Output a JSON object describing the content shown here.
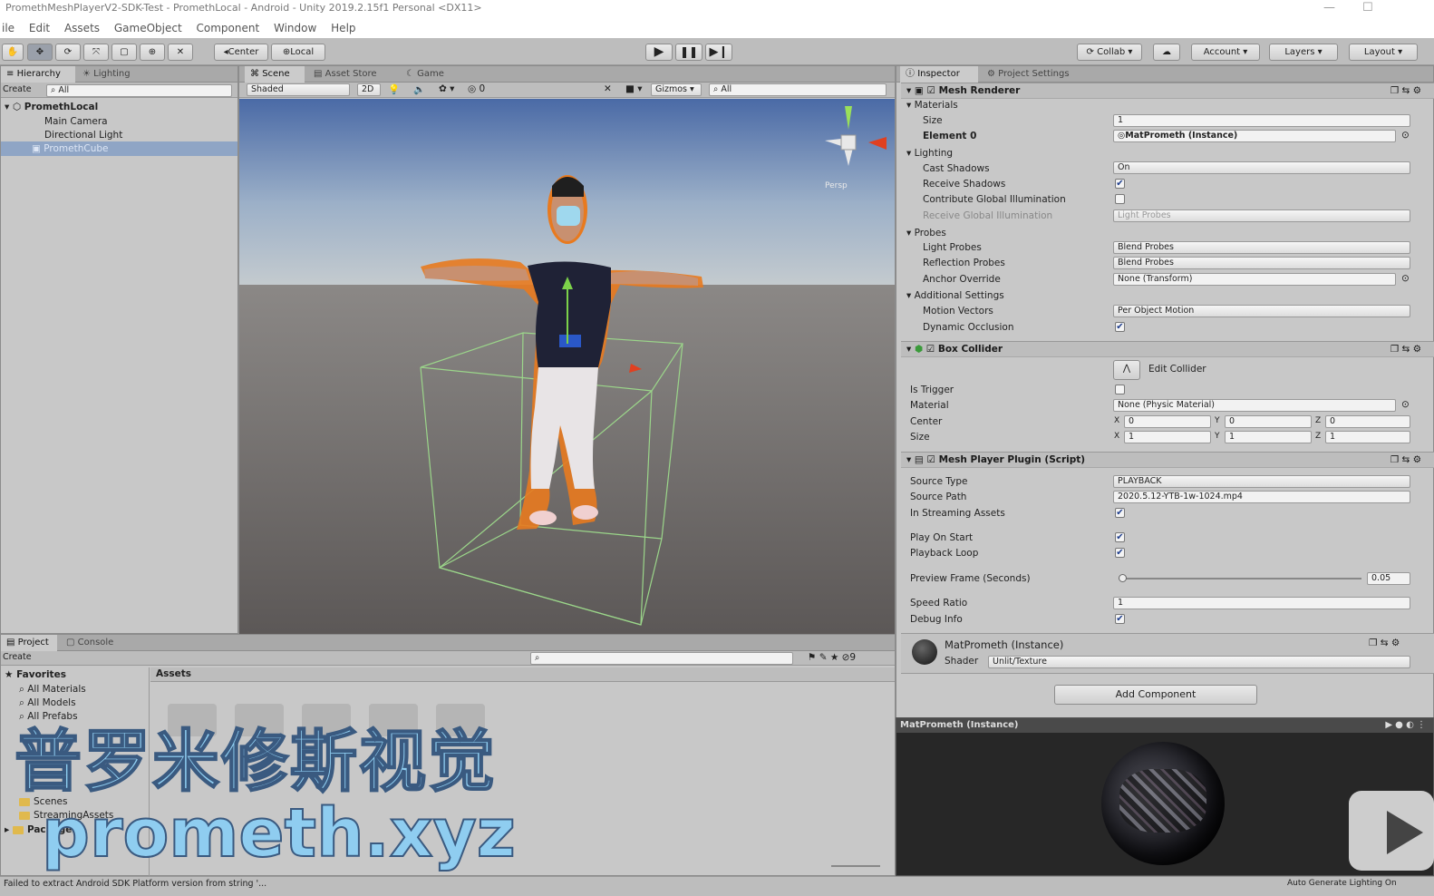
{
  "window": {
    "title": "PromethMeshPlayerV2-SDK-Test - PromethLocal - Android - Unity 2019.2.15f1 Personal <DX11>",
    "ctrl_min": "—",
    "ctrl_max": "☐"
  },
  "menu": [
    "ile",
    "Edit",
    "Assets",
    "GameObject",
    "Component",
    "Window",
    "Help"
  ],
  "toolbar": {
    "center": "Center",
    "local": "Local",
    "collab": "Collab",
    "account": "Account",
    "layers": "Layers",
    "layout": "Layout"
  },
  "hierarchy": {
    "tabs": [
      "Hierarchy",
      "Lighting"
    ],
    "create": "Create",
    "search": "All",
    "scene": "PromethLocal",
    "items": [
      "Main Camera",
      "Directional Light",
      "PromethCube"
    ]
  },
  "scene": {
    "tabs": [
      "Scene",
      "Asset Store",
      "Game"
    ],
    "shading": "Shaded",
    "mode2d": "2D",
    "fx_count": "0",
    "gizmos": "Gizmos",
    "search": "All",
    "persp": "Persp"
  },
  "inspector": {
    "tabs": [
      "Inspector",
      "Project Settings"
    ],
    "mesh_renderer": {
      "title": "Mesh Renderer",
      "materials": "Materials",
      "size_label": "Size",
      "size": "1",
      "element_label": "Element 0",
      "element": "MatPrometh (Instance)",
      "lighting": "Lighting",
      "cast_shadows_label": "Cast Shadows",
      "cast_shadows": "On",
      "receive_shadows": "Receive Shadows",
      "contribute_gi": "Contribute Global Illumination",
      "receive_gi_label": "Receive Global Illumination",
      "receive_gi": "Light Probes",
      "probes": "Probes",
      "light_probes_label": "Light Probes",
      "light_probes": "Blend Probes",
      "reflection_label": "Reflection Probes",
      "reflection": "Blend Probes",
      "anchor_label": "Anchor Override",
      "anchor": "None (Transform)",
      "additional": "Additional Settings",
      "motion_label": "Motion Vectors",
      "motion": "Per Object Motion",
      "dynamic_occlusion": "Dynamic Occlusion"
    },
    "box_collider": {
      "title": "Box Collider",
      "edit": "Edit Collider",
      "is_trigger": "Is Trigger",
      "material_label": "Material",
      "material": "None (Physic Material)",
      "center_label": "Center",
      "center": [
        "0",
        "0",
        "0"
      ],
      "size_label": "Size",
      "size": [
        "1",
        "1",
        "1"
      ],
      "axes": [
        "X",
        "Y",
        "Z"
      ]
    },
    "script": {
      "title": "Mesh Player Plugin (Script)",
      "source_type_label": "Source Type",
      "source_type": "PLAYBACK",
      "source_path_label": "Source Path",
      "source_path": "2020.5.12-YTB-1w-1024.mp4",
      "streaming": "In Streaming Assets",
      "play_on_start": "Play On Start",
      "loop": "Playback Loop",
      "preview_label": "Preview Frame (Seconds)",
      "preview": "0.05",
      "preview_fraction": 0.0,
      "speed_label": "Speed Ratio",
      "speed": "1",
      "debug": "Debug Info"
    },
    "material": {
      "name": "MatPrometh (Instance)",
      "shader_label": "Shader",
      "shader": "Unlit/Texture"
    },
    "add_component": "Add Component",
    "preview_title": "MatPrometh (Instance)"
  },
  "project": {
    "tabs": [
      "Project",
      "Console"
    ],
    "create": "Create",
    "favorites": "Favorites",
    "fav_items": [
      "All Materials",
      "All Models",
      "All Prefabs"
    ],
    "assets_header": "Assets",
    "tree": [
      "Scenes",
      "StreamingAssets"
    ],
    "packages": "Packages"
  },
  "overlay": {
    "chinese": "普罗米修斯视觉",
    "url": "prometh.xyz"
  },
  "status": {
    "message": "Failed to extract Android SDK Platform version from string '...",
    "right": "Auto Generate Lighting On"
  }
}
